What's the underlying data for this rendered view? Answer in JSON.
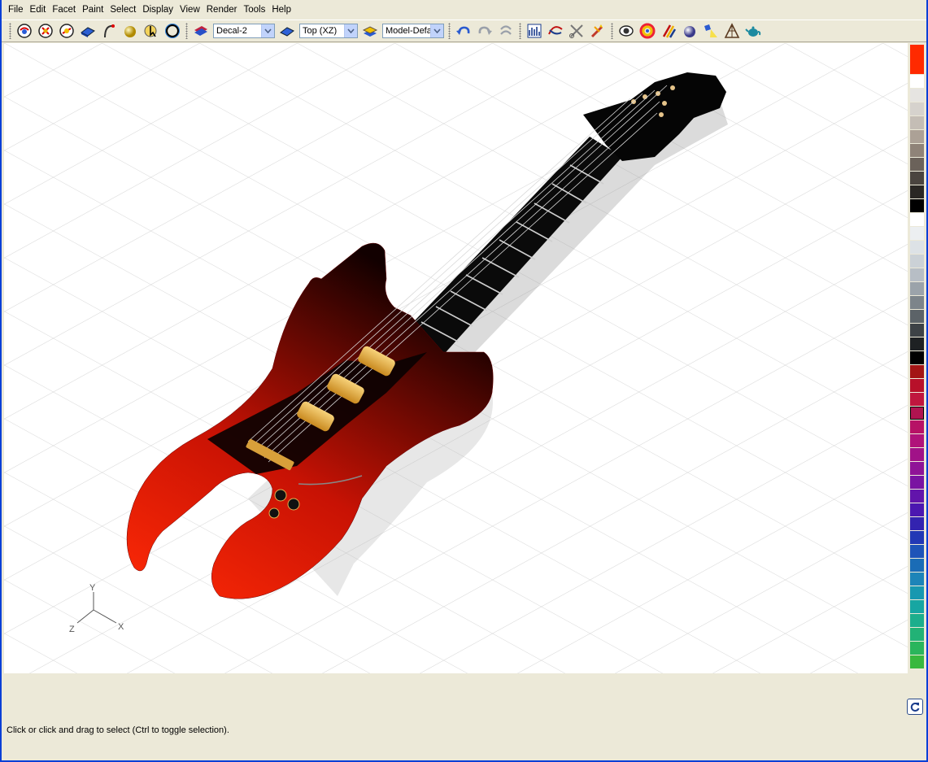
{
  "menu": [
    "File",
    "Edit",
    "Facet",
    "Paint",
    "Select",
    "Display",
    "View",
    "Render",
    "Tools",
    "Help"
  ],
  "toolbar": {
    "group1_icons": [
      "view-rotate-icon",
      "view-pan-icon",
      "view-zoom-icon",
      "plane-tool-icon",
      "curve-tool-icon",
      "sphere-light-icon",
      "select-cursor-icon",
      "circle-tool-icon"
    ],
    "decal_icon": "decal-book-icon",
    "decal_select": "Decal-2",
    "view_icon": "view-plane-icon",
    "view_select": "Top (XZ)",
    "model_icon": "model-layer-icon",
    "model_select": "Model-Defa",
    "group2_icons": [
      "undo-icon",
      "redo-icon",
      "repeat-icon"
    ],
    "group3_icons": [
      "histogram-icon",
      "curve-edit-icon",
      "scissors-icon",
      "magic-wand-icon"
    ],
    "group4_icons": [
      "eye-icon",
      "color-wheel-icon",
      "paint-brushes-icon",
      "material-sphere-icon",
      "spotlight-icon",
      "perspective-icon",
      "teapot-icon"
    ]
  },
  "axes": {
    "x": "X",
    "y": "Y",
    "z": "Z"
  },
  "palette_colors": [
    "#ff2a00",
    "#ffffff",
    "#e6e4e1",
    "#d6d2cd",
    "#c4bdb5",
    "#aca196",
    "#8f8378",
    "#6b625a",
    "#4a443f",
    "#2a2724",
    "#000000",
    "#ffffff",
    "#eceff1",
    "#dde2e6",
    "#cbd1d6",
    "#b7bec5",
    "#9ba3aa",
    "#7c848a",
    "#5c6368",
    "#3d4246",
    "#1e2123",
    "#000000",
    "#a31515",
    "#b8102a",
    "#c0163e",
    "#b01450",
    "#b71266",
    "#b0137a",
    "#a11288",
    "#8f1397",
    "#7a13a2",
    "#6214ab",
    "#4c17b0",
    "#3323b0",
    "#2238b5",
    "#1e54b8",
    "#1a6cb6",
    "#1d84b8",
    "#1898b0",
    "#17a6a2",
    "#1cae8c",
    "#22b276",
    "#2ab55c",
    "#38b83e"
  ],
  "palette_selected_index": 25,
  "status": {
    "text": "Click or click and drag to select (Ctrl to toggle selection)."
  },
  "colors": {
    "guitar_body": "#d41a04",
    "guitar_dark": "#120000",
    "pickup": "#e8b04a",
    "headstock": "#000000"
  }
}
